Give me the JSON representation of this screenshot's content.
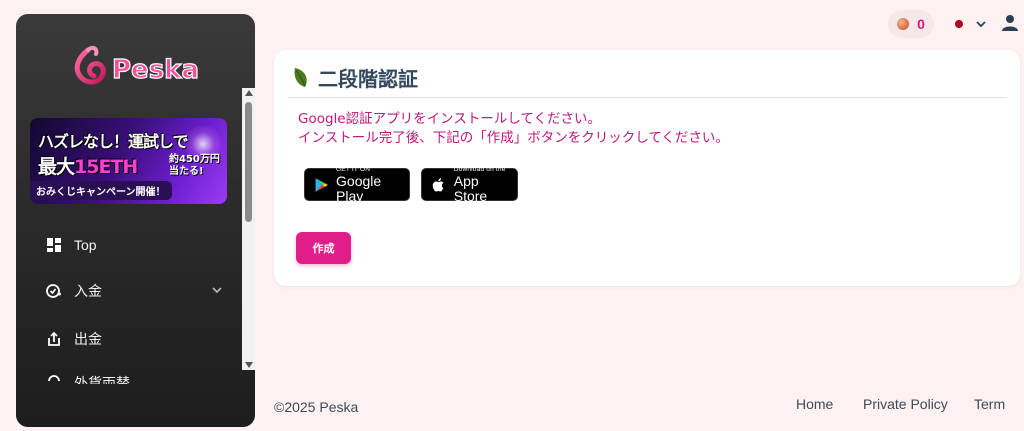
{
  "brand": {
    "logo_text": "Peska"
  },
  "banner": {
    "line1": "ハズレなし！運試しで",
    "line2_prefix": "最大",
    "line2_highlight": "15ETH",
    "line2_side": "約450万円当たる!",
    "line3": "おみくじキャンペーン開催！"
  },
  "sidebar": {
    "items": [
      {
        "label": "Top",
        "icon": "dashboard-icon"
      },
      {
        "label": "入金",
        "icon": "deposit-icon",
        "has_chevron": true
      },
      {
        "label": "出金",
        "icon": "withdraw-icon"
      },
      {
        "label": "外貨両替",
        "icon": "exchange-icon"
      }
    ]
  },
  "header": {
    "coin_count": "0",
    "coin_icon": "coin-icon",
    "language_flag": "flag-icon",
    "user_icon": "user-icon"
  },
  "card": {
    "title": "二段階認証",
    "instruction_line1": "Google認証アプリをインストールしてください。",
    "instruction_line2": "インストール完了後、下記の「作成」ボタンをクリックしてください。",
    "google_play": {
      "small": "GET IT ON",
      "big": "Google Play"
    },
    "app_store": {
      "small": "Download on the",
      "big": "App Store"
    },
    "create_button": "作成"
  },
  "footer": {
    "copyright": "©2025 Peska",
    "links": [
      "Home",
      "Private Policy",
      "Term"
    ]
  },
  "colors": {
    "accent": "#e11d8a",
    "instruction_text": "#c2187a",
    "title_text": "#34495e",
    "page_bg": "#fdf1f1"
  }
}
